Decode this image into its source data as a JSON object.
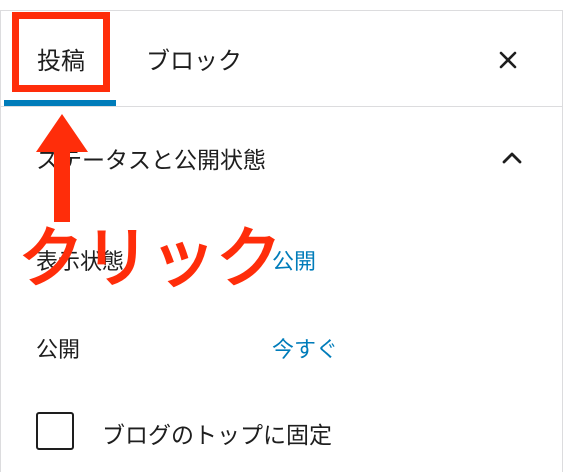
{
  "tabs": [
    {
      "label": "投稿",
      "active": true
    },
    {
      "label": "ブロック",
      "active": false
    }
  ],
  "close": {
    "icon": "close-icon",
    "glyph": "✕"
  },
  "section": {
    "title": "ステータスと公開状態",
    "expanded": true
  },
  "fields": {
    "visibility": {
      "label": "表示状態",
      "value": "公開"
    },
    "publish": {
      "label": "公開",
      "value": "今すぐ"
    }
  },
  "sticky": {
    "label": "ブログのトップに固定",
    "checked": false
  },
  "annotation": {
    "text": "クリック"
  },
  "colors": {
    "accent": "#007cba",
    "annotation": "#ff2d0a",
    "text": "#1e1e1e",
    "border": "#dcdcde"
  }
}
